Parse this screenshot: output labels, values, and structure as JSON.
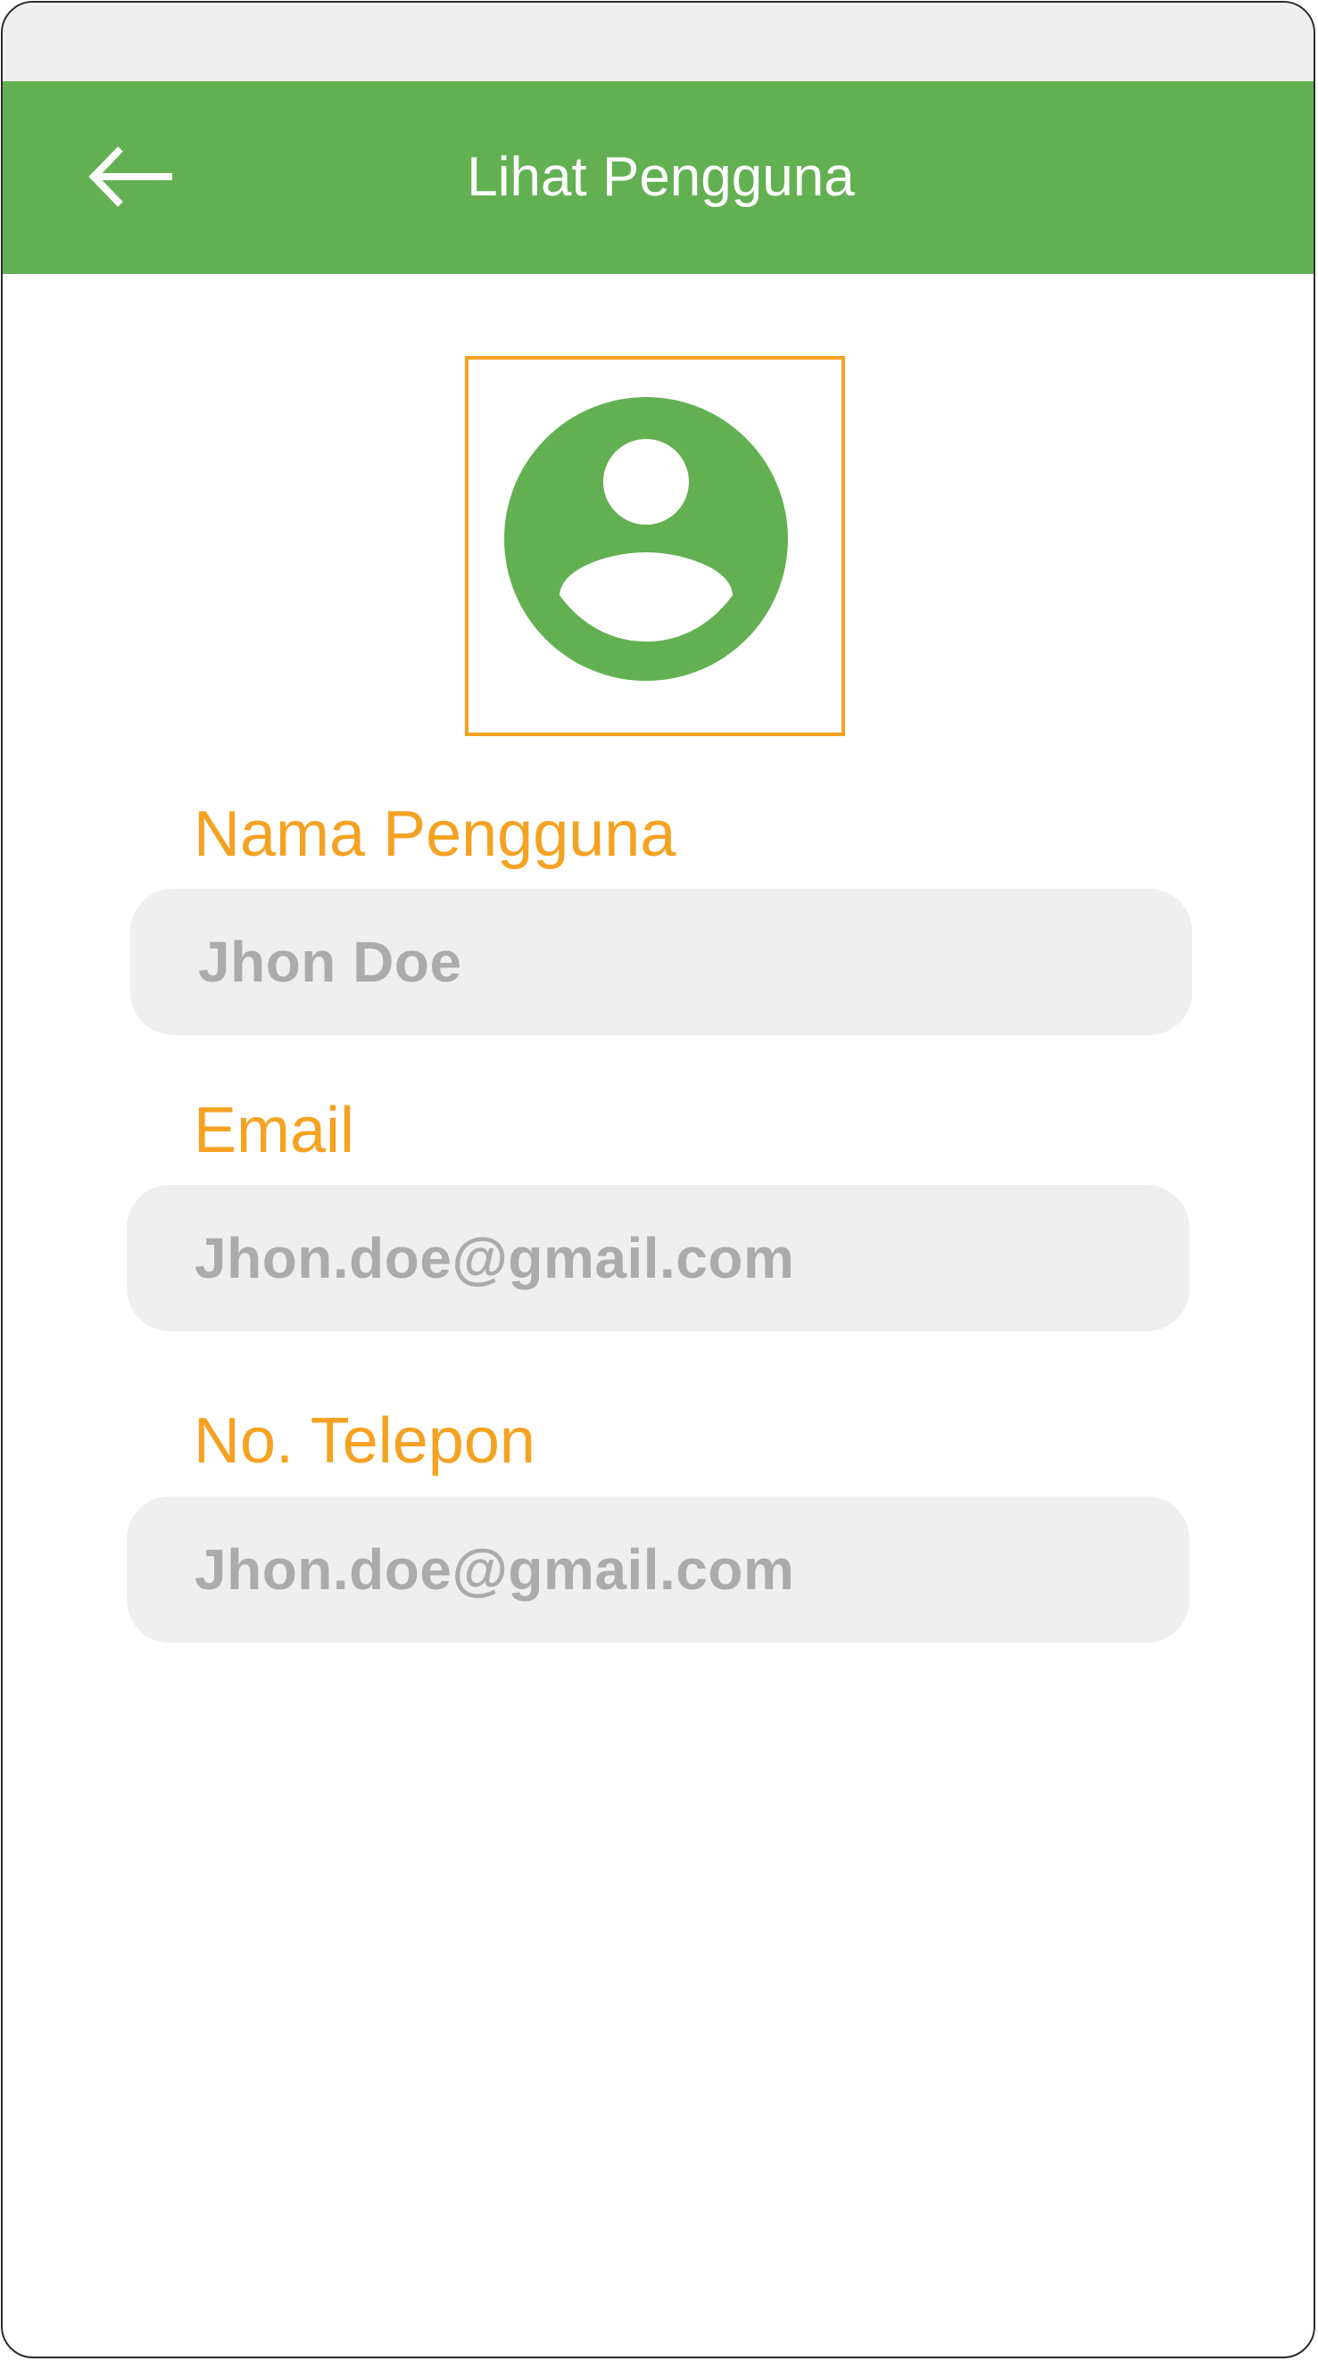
{
  "header": {
    "title": "Lihat Pengguna",
    "back_icon": "arrow-left-icon"
  },
  "avatar": {
    "icon": "user-avatar-icon"
  },
  "fields": {
    "username": {
      "label": "Nama Pengguna",
      "value": "Jhon Doe"
    },
    "email": {
      "label": "Email",
      "value": "Jhon.doe@gmail.com"
    },
    "phone": {
      "label": "No. Telepon",
      "value": "Jhon.doe@gmail.com"
    }
  },
  "colors": {
    "primary_green": "#62b052",
    "accent_orange": "#f5a223",
    "field_bg": "#efefef",
    "field_text": "#ababab",
    "status_bar": "#efefef"
  }
}
